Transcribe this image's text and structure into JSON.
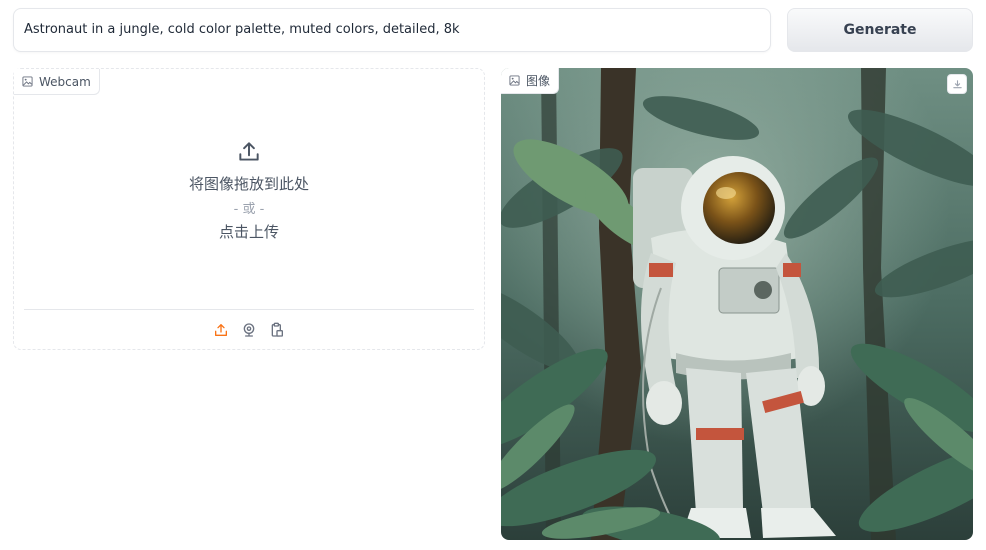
{
  "prompt": {
    "value": "Astronaut in a jungle, cold color palette, muted colors, detailed, 8k"
  },
  "generate_button": {
    "label": "Generate"
  },
  "input_panel": {
    "tag_label": "Webcam",
    "tag_icon": "image-icon",
    "drop_text": "将图像拖放到此处",
    "or_text": "- 或 -",
    "click_text": "点击上传",
    "upload_icon": "upload-icon",
    "sources": [
      "upload-icon",
      "webcam-icon",
      "clipboard-icon"
    ],
    "active_source_color": "#f97316"
  },
  "output_panel": {
    "tag_label": "图像",
    "tag_icon": "image-icon",
    "download_icon": "download-icon"
  }
}
